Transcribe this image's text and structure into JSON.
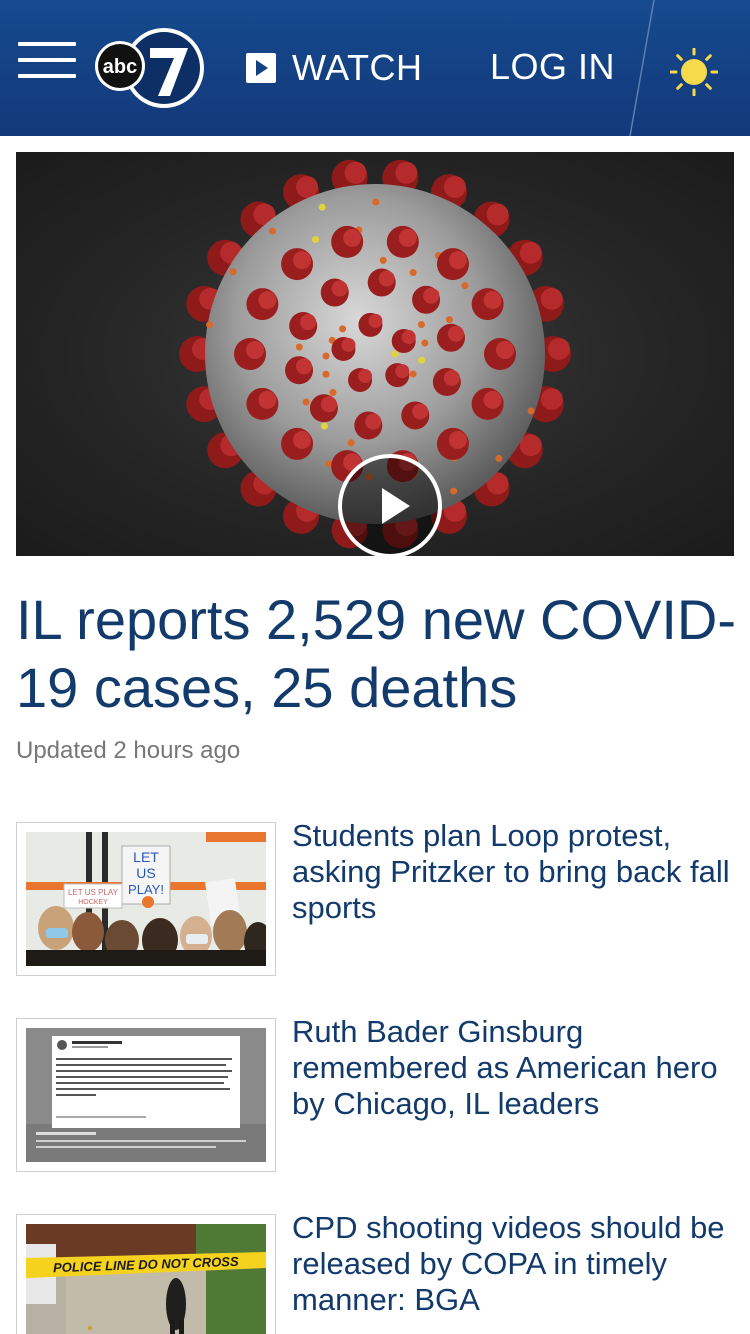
{
  "header": {
    "logo_text": "abc",
    "logo_number": "7",
    "watch_label": "WATCH",
    "login_label": "LOG IN",
    "weather_icon": "sun-icon",
    "brand_color": "#13407f"
  },
  "hero": {
    "media": "coronavirus-video",
    "headline": "IL reports 2,529 new COVID-19 cases, 25 deaths",
    "updated": "Updated 2 hours ago"
  },
  "stories": [
    {
      "title": "Students plan Loop protest, asking Pritzker to bring back fall sports",
      "thumb_sign_1": "LET US PLAY!",
      "thumb_sign_2": "LET US PLAY HOCKEY"
    },
    {
      "title": "Ruth Bader Ginsburg remembered as American hero by Chicago, IL leaders",
      "thumb_tweet_author": "Mayor Lori Lightfoot",
      "thumb_tweet_text": "Devastated by the passing of RBG. She represented the finest among lawyers in our country. A giant in her advocacy for women's rights, civil rights and respect for the rule of law. We must honor her legacy and all her contributions to American jurisprudence. Rest in power, RBG."
    },
    {
      "title": "CPD shooting videos should be released by COPA in timely manner: BGA",
      "thumb_tape_text": "POLICE LINE DO NOT CROSS"
    }
  ]
}
